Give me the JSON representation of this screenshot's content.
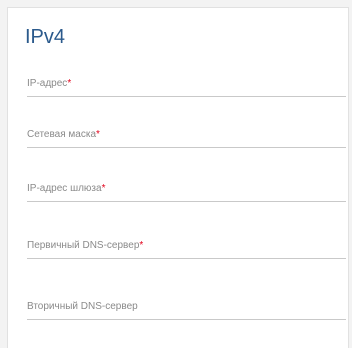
{
  "section": {
    "title": "IPv4"
  },
  "fields": [
    {
      "label": "IP-адрес",
      "required_mark": "*"
    },
    {
      "label": "Сетевая маска",
      "required_mark": "*"
    },
    {
      "label": "IP-адрес шлюза",
      "required_mark": "*"
    },
    {
      "label": "Первичный DNS-сервер",
      "required_mark": "*"
    },
    {
      "label": "Вторичный DNS-сервер",
      "required_mark": ""
    }
  ],
  "colors": {
    "title": "#2b5a8c",
    "label": "#8a8a8a",
    "required": "#e2001a",
    "underline": "#c9c9c9"
  }
}
